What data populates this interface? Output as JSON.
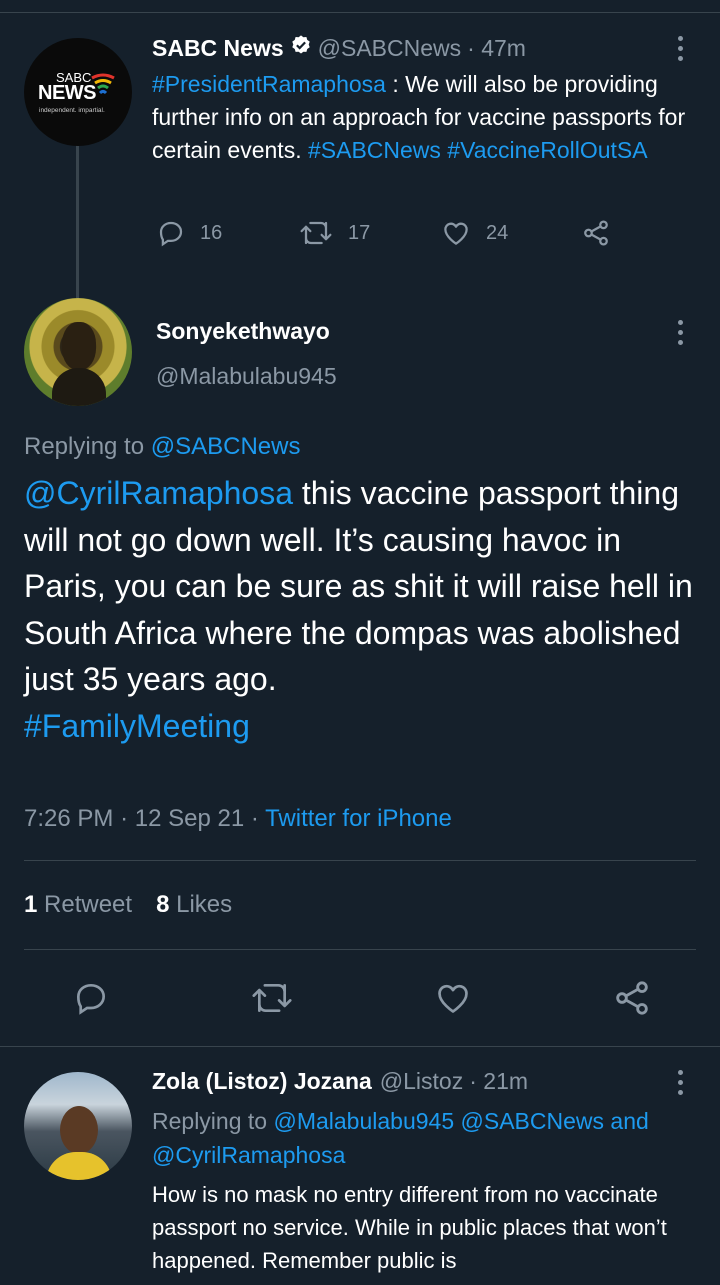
{
  "tweet1": {
    "author_name": "SABC News",
    "handle": "@SABCNews",
    "time": "· 47m",
    "avatar_logo": "SABC NEWS",
    "avatar_tagline": "independent. impartial.",
    "text_parts": [
      {
        "text": "#PresidentRamaphosa",
        "type": "link"
      },
      {
        "text": " : We will also be providing further info on an approach for vaccine passports for certain events. ",
        "type": "text"
      },
      {
        "text": "#SABCNews",
        "type": "link"
      },
      {
        "text": " ",
        "type": "text"
      },
      {
        "text": "#VaccineRollOutSA",
        "type": "link"
      }
    ],
    "replies": "16",
    "retweets": "17",
    "likes": "24"
  },
  "main_tweet": {
    "author_name": "Sonyekethwayo",
    "handle": "@Malabulabu945",
    "replying_label": "Replying to",
    "replying_to": "@SABCNews",
    "text_parts": [
      {
        "text": "@CyrilRamaphosa",
        "type": "link"
      },
      {
        "text": " this vaccine passport thing will not go down well. It’s causing havoc in Paris, you can be sure as shit it will raise hell in South Africa where the dompas was abolished just 35 years ago.",
        "type": "text"
      },
      {
        "text": "\n",
        "type": "text"
      },
      {
        "text": "#FamilyMeeting",
        "type": "link"
      }
    ],
    "time": "7:26 PM",
    "date": "12 Sep 21",
    "source": "Twitter for iPhone",
    "retweet_count": "1",
    "retweet_label": "Retweet",
    "like_count": "8",
    "like_label": "Likes"
  },
  "reply": {
    "author_name": "Zola (Listoz) Jozana",
    "handle": "@Listoz",
    "time": "· 21m",
    "replying_label": "Replying to",
    "replying_to_1": "@Malabulabu945",
    "replying_to_2": "@SABCNews",
    "replying_and": "and",
    "replying_to_3": "@CyrilRamaphosa",
    "text": "How is no mask no entry different from no vaccinate passport no service. While in public places that won’t happened. Remember public is"
  },
  "colors": {
    "background": "#15202b",
    "link": "#1d9bf0",
    "muted": "#8b98a5",
    "divider": "#38444d"
  },
  "icons": [
    "verified-badge-icon",
    "more-options-icon",
    "reply-icon",
    "retweet-icon",
    "like-icon",
    "share-icon"
  ]
}
